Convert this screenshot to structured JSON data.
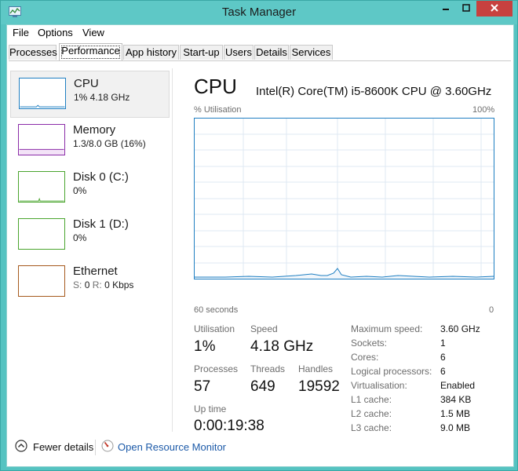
{
  "window": {
    "title": "Task Manager"
  },
  "menu": {
    "file": "File",
    "options": "Options",
    "view": "View"
  },
  "tabs": [
    {
      "label": "Processes"
    },
    {
      "label": "Performance"
    },
    {
      "label": "App history"
    },
    {
      "label": "Start-up"
    },
    {
      "label": "Users"
    },
    {
      "label": "Details"
    },
    {
      "label": "Services"
    }
  ],
  "active_tab": "Performance",
  "sidebar": {
    "items": [
      {
        "name": "CPU",
        "detail": "1% 4.18 GHz",
        "color": "#1f7fc2",
        "selected": true
      },
      {
        "name": "Memory",
        "detail": "1.3/8.0 GB (16%)",
        "color": "#8b2ca8"
      },
      {
        "name": "Disk 0 (C:)",
        "detail": "0%",
        "color": "#4aa52e"
      },
      {
        "name": "Disk 1 (D:)",
        "detail": "0%",
        "color": "#4aa52e"
      },
      {
        "name": "Ethernet",
        "detail_s_label": "S:",
        "detail_s_value": "0",
        "detail_r_label": "R:",
        "detail_r_value": "0 Kbps",
        "color": "#a65a1e"
      }
    ]
  },
  "cpu": {
    "title": "CPU",
    "model": "Intel(R) Core(TM) i5-8600K CPU @ 3.60GHz",
    "graph": {
      "y_label": "% Utilisation",
      "y_max_label": "100%",
      "x_left_label": "60 seconds",
      "x_right_label": "0",
      "line_color": "#1f7fc2"
    },
    "stats": {
      "utilisation_label": "Utilisation",
      "utilisation": "1%",
      "speed_label": "Speed",
      "speed": "4.18 GHz",
      "processes_label": "Processes",
      "processes": "57",
      "threads_label": "Threads",
      "threads": "649",
      "handles_label": "Handles",
      "handles": "19592",
      "uptime_label": "Up time",
      "uptime": "0:00:19:38"
    },
    "details": [
      {
        "label": "Maximum speed:",
        "value": "3.60 GHz"
      },
      {
        "label": "Sockets:",
        "value": "1"
      },
      {
        "label": "Cores:",
        "value": "6"
      },
      {
        "label": "Logical processors:",
        "value": "6"
      },
      {
        "label": "Virtualisation:",
        "value": "Enabled"
      },
      {
        "label": "L1 cache:",
        "value": "384 KB"
      },
      {
        "label": "L2 cache:",
        "value": "1.5 MB"
      },
      {
        "label": "L3 cache:",
        "value": "9.0 MB"
      }
    ]
  },
  "footer": {
    "fewer_details": "Fewer details",
    "open_resource_monitor": "Open Resource Monitor"
  }
}
